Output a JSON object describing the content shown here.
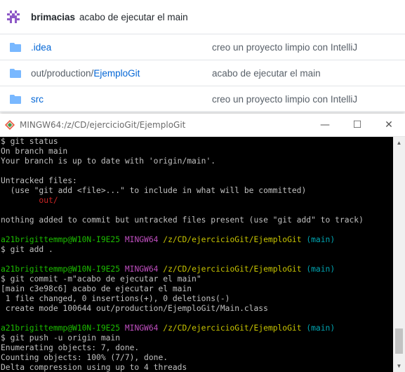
{
  "repo": {
    "last_commit": {
      "author": "brimacias",
      "message": "acabo de ejecutar el main"
    },
    "files": [
      {
        "name": ".idea",
        "name_prefix": ".idea",
        "name_suffix": "",
        "message": "creo un proyecto limpio con IntelliJ"
      },
      {
        "name": "out/production/EjemploGit",
        "name_prefix": "out/production/",
        "name_suffix": "EjemploGit",
        "message": "acabo de ejecutar el main"
      },
      {
        "name": "src",
        "name_prefix": "src",
        "name_suffix": "",
        "message": "creo un proyecto limpio con IntelliJ"
      }
    ],
    "colors": {
      "link": "#0366d6",
      "folder": "#79b8ff",
      "avatar": "#8e59c7"
    }
  },
  "terminal": {
    "title": "MINGW64:/z/CD/ejercicioGit/EjemploGit",
    "buttons": {
      "minimize": "—",
      "maximize": "☐",
      "close": "✕"
    },
    "colors": {
      "background": "#000000",
      "text": "#c0c0c0",
      "user": "#1cbd00",
      "mingw": "#bf4ebf",
      "path": "#c7c400",
      "branch": "#00a6b2",
      "untracked": "#cc2525"
    },
    "lines": [
      [
        {
          "t": "$ git status",
          "c": ""
        }
      ],
      [
        {
          "t": "On branch main",
          "c": ""
        }
      ],
      [
        {
          "t": "Your branch is up to date with 'origin/main'.",
          "c": ""
        }
      ],
      [
        {
          "t": "",
          "c": ""
        }
      ],
      [
        {
          "t": "Untracked files:",
          "c": ""
        }
      ],
      [
        {
          "t": "  (use \"git add <file>...\" to include in what will be committed)",
          "c": ""
        }
      ],
      [
        {
          "t": "        out/",
          "c": "c-red"
        }
      ],
      [
        {
          "t": "",
          "c": ""
        }
      ],
      [
        {
          "t": "nothing added to commit but untracked files present (use \"git add\" to track)",
          "c": ""
        }
      ],
      [
        {
          "t": "",
          "c": ""
        }
      ],
      [
        {
          "t": "a21brigittemmp@W10N-I9E25",
          "c": "c-green"
        },
        {
          "t": " MINGW64",
          "c": "c-magenta"
        },
        {
          "t": " /z/CD/ejercicioGit/EjemploGit",
          "c": "c-yellow"
        },
        {
          "t": " (main)",
          "c": "c-cyan"
        }
      ],
      [
        {
          "t": "$ git add .",
          "c": ""
        }
      ],
      [
        {
          "t": "",
          "c": ""
        }
      ],
      [
        {
          "t": "a21brigittemmp@W10N-I9E25",
          "c": "c-green"
        },
        {
          "t": " MINGW64",
          "c": "c-magenta"
        },
        {
          "t": " /z/CD/ejercicioGit/EjemploGit",
          "c": "c-yellow"
        },
        {
          "t": " (main)",
          "c": "c-cyan"
        }
      ],
      [
        {
          "t": "$ git commit -m\"acabo de ejecutar el main\"",
          "c": ""
        }
      ],
      [
        {
          "t": "[main c3e98c6] acabo de ejecutar el main",
          "c": ""
        }
      ],
      [
        {
          "t": " 1 file changed, 0 insertions(+), 0 deletions(-)",
          "c": ""
        }
      ],
      [
        {
          "t": " create mode 100644 out/production/EjemploGit/Main.class",
          "c": ""
        }
      ],
      [
        {
          "t": "",
          "c": ""
        }
      ],
      [
        {
          "t": "a21brigittemmp@W10N-I9E25",
          "c": "c-green"
        },
        {
          "t": " MINGW64",
          "c": "c-magenta"
        },
        {
          "t": " /z/CD/ejercicioGit/EjemploGit",
          "c": "c-yellow"
        },
        {
          "t": " (main)",
          "c": "c-cyan"
        }
      ],
      [
        {
          "t": "$ git push -u origin main",
          "c": ""
        }
      ],
      [
        {
          "t": "Enumerating objects: 7, done.",
          "c": ""
        }
      ],
      [
        {
          "t": "Counting objects: 100% (7/7), done.",
          "c": ""
        }
      ],
      [
        {
          "t": "Delta compression using up to 4 threads",
          "c": ""
        }
      ]
    ]
  }
}
